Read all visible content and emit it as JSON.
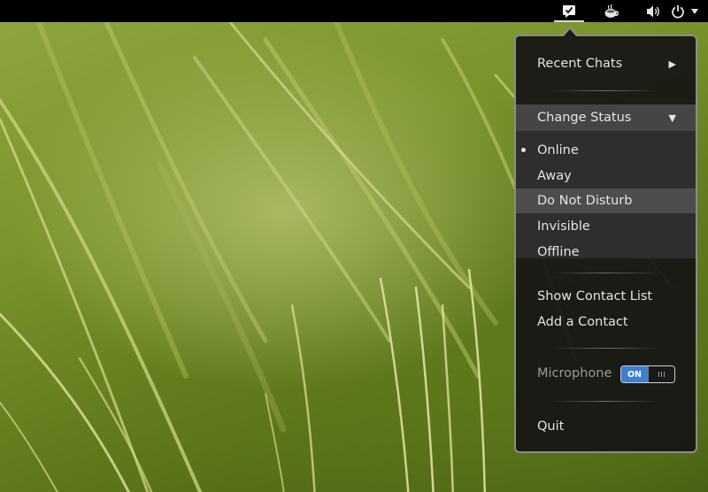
{
  "top_panel": {
    "tray_icons": [
      "empathy-chat-icon",
      "coffee-icon",
      "volume-icon",
      "power-icon"
    ]
  },
  "menu": {
    "recent_chats": "Recent Chats",
    "change_status": "Change Status",
    "status_options": [
      "Online",
      "Away",
      "Do Not Disturb",
      "Invisible",
      "Offline"
    ],
    "selected_status": "Online",
    "highlighted_status": "Do Not Disturb",
    "show_contact_list": "Show Contact List",
    "add_contact": "Add a Contact",
    "microphone": "Microphone",
    "microphone_toggle": "ON",
    "quit": "Quit"
  },
  "colors": {
    "panel_bg": "#000000",
    "menu_bg": "#141414",
    "menu_border": "#8b8b8b",
    "toggle_on": "#3d7fd1"
  }
}
